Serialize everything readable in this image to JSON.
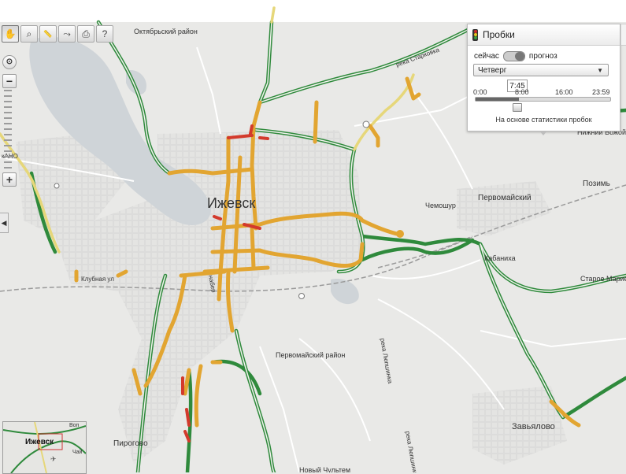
{
  "toolbar": {
    "tools": [
      {
        "icon": "hand-icon",
        "glyph": "✋",
        "active": true
      },
      {
        "icon": "zoom-area-icon",
        "glyph": "⌕",
        "active": false
      },
      {
        "icon": "ruler-icon",
        "glyph": "📏",
        "active": false
      },
      {
        "icon": "route-icon",
        "glyph": "⤳",
        "active": false
      },
      {
        "icon": "print-icon",
        "glyph": "⎙",
        "active": false
      },
      {
        "icon": "help-cursor-icon",
        "glyph": "?",
        "active": false
      }
    ]
  },
  "zoom": {
    "plus": "+",
    "minus": "−"
  },
  "traffic": {
    "title": "Пробки",
    "mode_now": "сейчас",
    "mode_forecast": "прогноз",
    "day": "Четверг",
    "ticks": [
      "0:00",
      "8:00",
      "16:00",
      "23:59"
    ],
    "time": "7:45",
    "time_fraction": 0.323,
    "note": "На основе статистики пробок",
    "colors": {
      "red": "#cc2a2a",
      "yellow": "#e8c21e",
      "green": "#3c9e3c"
    }
  },
  "map": {
    "labels": {
      "district_north": "Октябрьский район",
      "district_south": "Первомайский район",
      "city": "Ижевск",
      "pervomaysky": "Первомайский",
      "chemoshur": "Чемошур",
      "pozim": "Позимь",
      "kabanikha": "Кабаниха",
      "staroe_marie": "Старое Марие",
      "zavyalovo": "Завьялово",
      "pirogovo": "Пирогово",
      "novy_chultem": "Новый Чультем",
      "nizhny_vozhoy": "Нижний Вожой",
      "river_starkovka": "река Старковка",
      "river_lyuplinka": "река Люпшинка",
      "river_lyuplinka2": "река Люпшинка",
      "club_street": "Клубная ул",
      "naberezhnaya": "набер",
      "left_cut": "кАНО"
    },
    "colors": {
      "background": "#e9e9e7",
      "water": "#cfd4d8",
      "road_fill": "#ffffff",
      "jam_orange": "#e2a531",
      "jam_red": "#d33a2c",
      "highway_green": "#2f8a3c"
    }
  },
  "minimap": {
    "city": "Ижевск",
    "label_left": "Чай",
    "label_right": "Воп"
  }
}
